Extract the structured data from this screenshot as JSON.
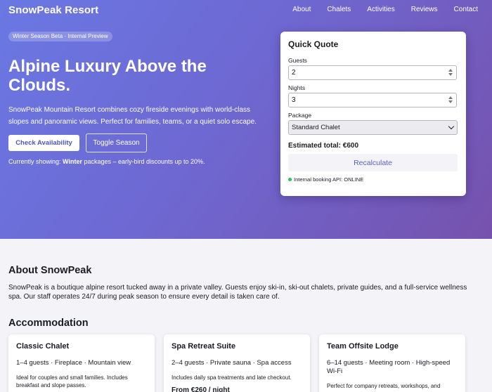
{
  "header": {
    "brand": "SnowPeak Resort",
    "nav": [
      "About",
      "Chalets",
      "Activities",
      "Reviews",
      "Contact"
    ]
  },
  "hero": {
    "badge": "Winter Season Beta · Internal Preview",
    "title": "Alpine Luxury Above the Clouds.",
    "description": "SnowPeak Mountain Resort combines cozy fireside evenings with world-class slopes and panoramic views. Perfect for families, teams, or a quiet solo escape.",
    "check_button": "Check Availability",
    "toggle_button": "Toggle Season",
    "showing_prefix": "Currently showing: ",
    "showing_season": "Winter",
    "showing_suffix": " packages – early-bird discounts up to 20%."
  },
  "quote": {
    "title": "Quick Quote",
    "guests_label": "Guests",
    "guests_value": "2",
    "nights_label": "Nights",
    "nights_value": "3",
    "package_label": "Package",
    "package_value": "Standard Chalet",
    "total": "Estimated total: €600",
    "recalc_button": "Recalculate",
    "api_status": "Internal booking API: ONLINE",
    "status_color": "#22c55e"
  },
  "about": {
    "title": "About SnowPeak",
    "text": "SnowPeak is a boutique alpine resort tucked away in a private valley. Guests enjoy ski-in, ski-out chalets, private guides, and a full-service wellness spa. Our staff operates 24/7 during peak season to ensure every detail is taken care of."
  },
  "accommodation": {
    "title": "Accommodation",
    "cards": [
      {
        "name": "Classic Chalet",
        "meta": "1–4 guests · Fireplace · Mountain view",
        "desc": "Ideal for couples and small families. Includes breakfast and slope passes."
      },
      {
        "name": "Spa Retreat Suite",
        "meta": "2–4 guests · Private sauna · Spa access",
        "desc": "Includes daily spa treatments and late checkout.",
        "price": "From €260 / night"
      },
      {
        "name": "Team Offsite Lodge",
        "meta": "6–14 guests · Meeting room · High-speed Wi-Fi",
        "desc": "Perfect for company retreats, workshops, and"
      }
    ]
  }
}
